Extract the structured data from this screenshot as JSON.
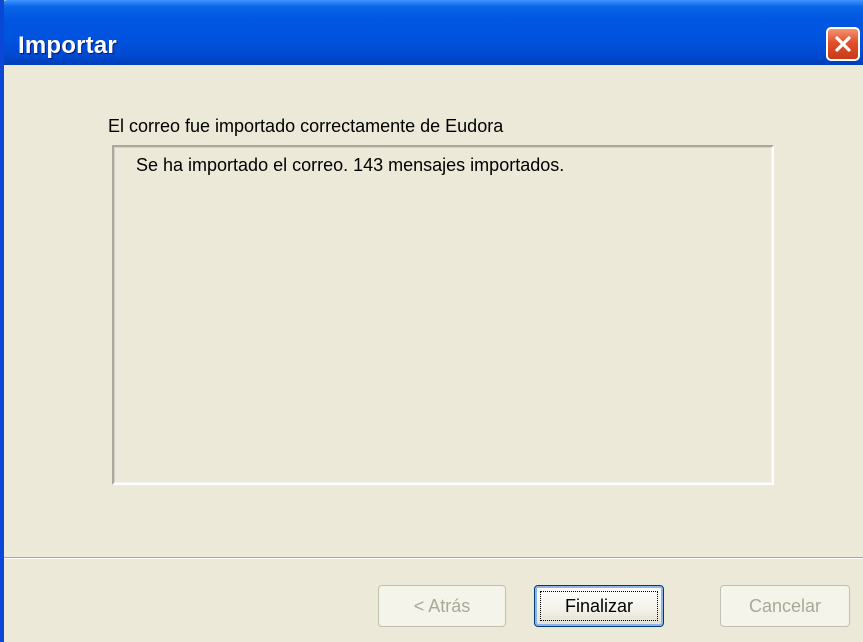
{
  "window": {
    "title": "Importar",
    "close_icon": "close-icon"
  },
  "main": {
    "status_label": "El correo fue importado correctamente de Eudora",
    "result_text": "Se ha importado el correo. 143 mensajes importados."
  },
  "buttons": {
    "back_label": "< Atrás",
    "finish_label": "Finalizar",
    "cancel_label": "Cancelar",
    "back_enabled": false,
    "finish_enabled": true,
    "cancel_enabled": false
  },
  "colors": {
    "titlebar": "#0053df",
    "dialog_bg": "#ece9d8",
    "close_button": "#e0502a",
    "disabled_text": "#aca899"
  }
}
